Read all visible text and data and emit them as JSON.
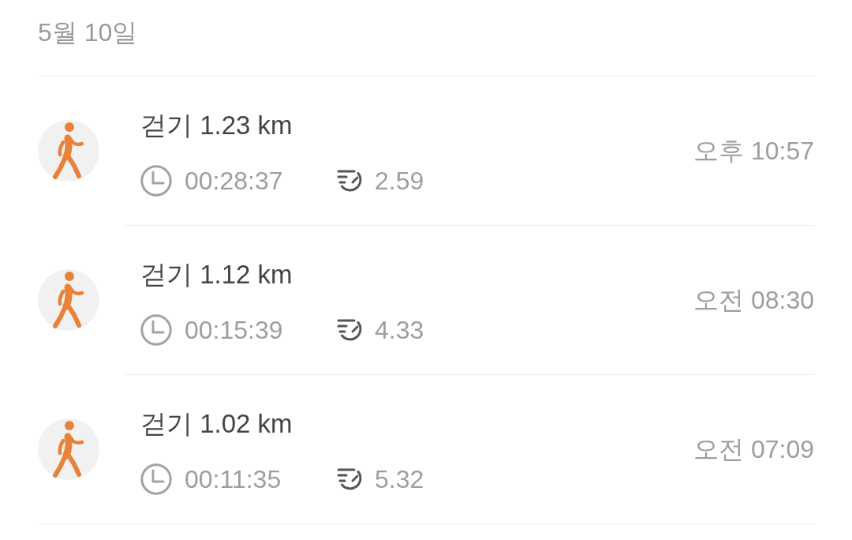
{
  "date_header": "5월 10일",
  "activities": [
    {
      "title": "걷기 1.23 km",
      "duration": "00:28:37",
      "pace": "2.59",
      "time": "오후 10:57"
    },
    {
      "title": "걷기 1.12 km",
      "duration": "00:15:39",
      "pace": "4.33",
      "time": "오전 08:30"
    },
    {
      "title": "걷기 1.02 km",
      "duration": "00:11:35",
      "pace": "5.32",
      "time": "오전 07:09"
    }
  ]
}
